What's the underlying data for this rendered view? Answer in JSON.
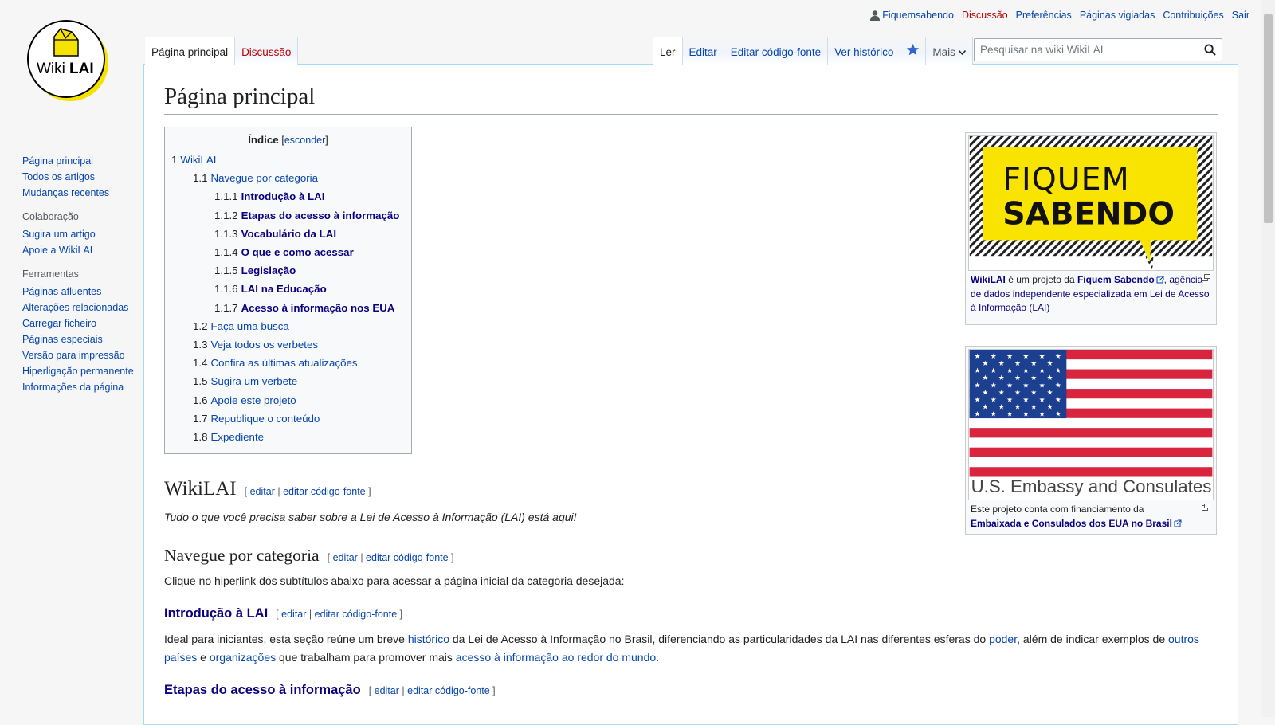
{
  "logo": {
    "text_a": "Wiki",
    "text_b": "LAI"
  },
  "personal_tools": {
    "user": "Fiquemsabendo",
    "talk": "Discussão",
    "preferences": "Preferências",
    "watchlist": "Páginas vigiadas",
    "contributions": "Contribuições",
    "logout": "Sair"
  },
  "tabs": {
    "page": "Página principal",
    "talk": "Discussão",
    "read": "Ler",
    "edit": "Editar",
    "edit_source": "Editar código-fonte",
    "history": "Ver histórico",
    "more": "Mais"
  },
  "search": {
    "placeholder": "Pesquisar na wiki WikiLAI"
  },
  "sidebar": {
    "nav": [
      "Página principal",
      "Todos os artigos",
      "Mudanças recentes"
    ],
    "collab_head": "Colaboração",
    "collab": [
      "Sugira um artigo",
      "Apoie a WikiLAI"
    ],
    "tools_head": "Ferramentas",
    "tools": [
      "Páginas afluentes",
      "Alterações relacionadas",
      "Carregar ficheiro",
      "Páginas especiais",
      "Versão para impressão",
      "Hiperligação permanente",
      "Informações da página"
    ]
  },
  "page": {
    "title": "Página principal"
  },
  "toc": {
    "title": "Índice",
    "hide": "esconder",
    "items": [
      {
        "num": "1",
        "text": "WikiLAI"
      },
      {
        "num": "1.1",
        "text": "Navegue por categoria"
      },
      {
        "num": "1.1.1",
        "text": "Introdução à LAI"
      },
      {
        "num": "1.1.2",
        "text": "Etapas do acesso à informação"
      },
      {
        "num": "1.1.3",
        "text": "Vocabulário da LAI"
      },
      {
        "num": "1.1.4",
        "text": "O que e como acessar"
      },
      {
        "num": "1.1.5",
        "text": "Legislação"
      },
      {
        "num": "1.1.6",
        "text": "LAI na Educação"
      },
      {
        "num": "1.1.7",
        "text": "Acesso à informação nos EUA"
      },
      {
        "num": "1.2",
        "text": "Faça uma busca"
      },
      {
        "num": "1.3",
        "text": "Veja todos os verbetes"
      },
      {
        "num": "1.4",
        "text": "Confira as últimas atualizações"
      },
      {
        "num": "1.5",
        "text": "Sugira um verbete"
      },
      {
        "num": "1.6",
        "text": "Apoie este projeto"
      },
      {
        "num": "1.7",
        "text": "Republique o conteúdo"
      },
      {
        "num": "1.8",
        "text": "Expediente"
      }
    ]
  },
  "infobox1": {
    "image_line1": "FIQUEM",
    "image_line2": "SABENDO",
    "cap_b1": "WikiLAI",
    "cap_t1": " é um projeto da ",
    "cap_b2": "Fiquem Sabendo",
    "cap_t2": ", agência de dados independente especializada em Lei de Acesso à Informação (LAI)"
  },
  "infobox2": {
    "image_text": "U.S. Embassy and Consulates",
    "cap_t1": "Este projeto conta com financiamento da",
    "cap_b1": "Embaixada e Consulados dos EUA no Brasil"
  },
  "editlinks": {
    "open": "[",
    "edit": "editar",
    "sep": " | ",
    "edit_source": "editar código-fonte",
    "close": "]"
  },
  "sections": {
    "wikilai": "WikiLAI",
    "wikilai_intro": "Tudo o que você precisa saber sobre a Lei de Acesso à Informação (LAI) está aqui!",
    "navegue": "Navegue por categoria",
    "navegue_intro": "Clique no hiperlink dos subtítulos abaixo para acessar a página inicial da categoria desejada:",
    "intro_lai": "Introdução à LAI",
    "intro_p": {
      "t1": "Ideal para iniciantes, esta seção reúne um breve ",
      "l1": "histórico",
      "t2": " da Lei de Acesso à Informação no Brasil, diferenciando as particularidades da LAI nas diferentes esferas do ",
      "l2": "poder",
      "t3": ", além de indicar exemplos de ",
      "l3": "outros países",
      "t4": " e ",
      "l4": "organizações",
      "t5": " que trabalham para promover mais ",
      "l5": "acesso à informação ao redor do mundo",
      "t6": "."
    },
    "etapas": "Etapas do acesso à informação"
  },
  "colors": {
    "link": "#0645ad",
    "link_visited": "#0b0080",
    "link_new": "#ba0000",
    "fs_yellow": "#f9e300",
    "flag_red": "#d8243d",
    "flag_blue": "#1c3f8f"
  }
}
